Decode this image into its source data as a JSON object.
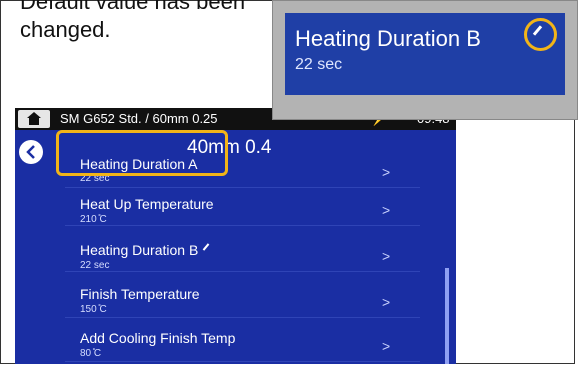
{
  "description": {
    "line1": "Default value has been",
    "line2": "changed."
  },
  "zoom": {
    "title": "Heating Duration B",
    "value": "22 sec"
  },
  "statusbar": {
    "title": "SM G652 Std. / 60mm 0.25",
    "battery": "⚡",
    "time": "09:48"
  },
  "header": {
    "title": "40mm 0.4"
  },
  "list": [
    {
      "label": "Heating Duration A",
      "value": "22 sec"
    },
    {
      "label": "Heat Up Temperature",
      "value": "210 ̊C"
    },
    {
      "label": "Heating Duration B",
      "value": "22 sec"
    },
    {
      "label": "Finish Temperature",
      "value": "150 ̊C"
    },
    {
      "label": "Add Cooling Finish Temp",
      "value": "80 ̊C"
    }
  ],
  "colors": {
    "screen_bg": "#1a2ea3",
    "highlight": "#f2b418",
    "callout_bg": "#b3b3b3"
  },
  "icons": {
    "home": "home-icon",
    "back": "back-arrow-icon",
    "chevron": "chevron-right-icon",
    "modified": "modified-mark-icon"
  }
}
